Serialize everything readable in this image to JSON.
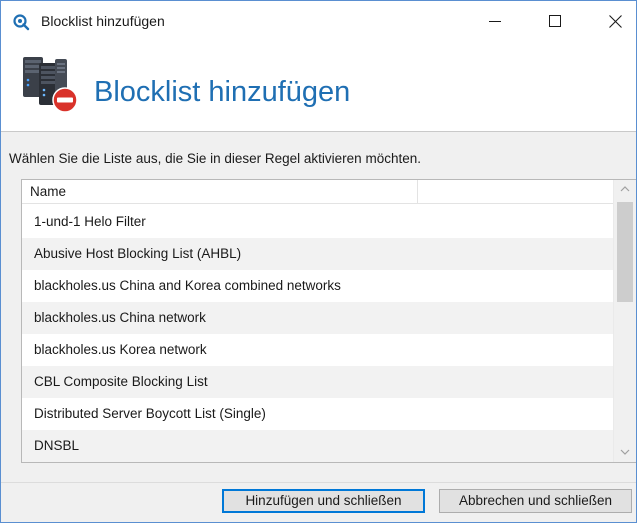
{
  "window": {
    "title": "Blocklist hinzufügen"
  },
  "header": {
    "title": "Blocklist hinzufügen",
    "icon": "server-block-icon"
  },
  "instruction": "Wählen Sie die Liste aus, die Sie in dieser Regel aktivieren möchten.",
  "list": {
    "columns": [
      "Name",
      ""
    ],
    "rows": [
      "1-und-1 Helo Filter",
      "Abusive Host Blocking List (AHBL)",
      "blackholes.us China and Korea combined networks",
      "blackholes.us China network",
      "blackholes.us Korea network",
      "CBL Composite Blocking List",
      "Distributed Server Boycott List (Single)",
      "DNSBL"
    ]
  },
  "buttons": {
    "add_close": "Hinzufügen und schließen",
    "cancel_close": "Abbrechen und schließen"
  },
  "colors": {
    "accent": "#1f6fb3",
    "window_border": "#5a8fd1",
    "focus_border": "#0078d7",
    "alt_row": "#f2f2f2"
  }
}
